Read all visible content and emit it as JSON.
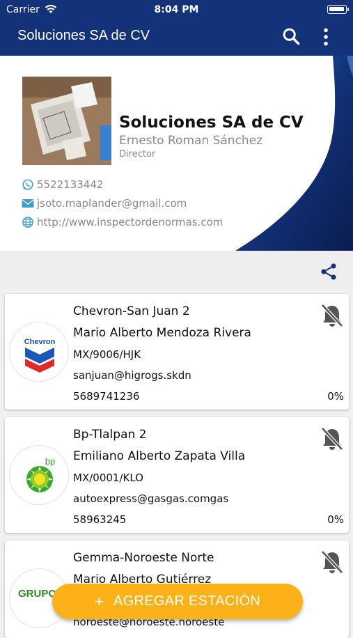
{
  "status_bar": {
    "carrier": "Carrier",
    "time": "8:04 PM"
  },
  "app_bar": {
    "title": "Soluciones SA de CV",
    "icons": [
      "search-icon",
      "more-vert-icon"
    ]
  },
  "profile": {
    "company": "Soluciones SA de CV",
    "person": "Ernesto Roman Sánchez",
    "role": "Director",
    "phone": "5522133442",
    "email": "jsoto.maplander@gmail.com",
    "website": "http://www.inspectordenormas.com"
  },
  "share_bar": {
    "icon": "share-icon"
  },
  "stations": [
    {
      "name": "Chevron-San Juan 2",
      "contact": "Mario Alberto Mendoza Rivera",
      "code": "MX/9006/HJK",
      "email": "sanjuan@higrogs.skdn",
      "phone": "5689741236",
      "progress": "0%",
      "brand": "Chevron",
      "notifications": "off"
    },
    {
      "name": "Bp-Tlalpan 2",
      "contact": "Emiliano Alberto  Zapata Villa",
      "code": "MX/0001/KLO",
      "email": "autoexpress@gasgas.comgas",
      "phone": "58963245",
      "progress": "0%",
      "brand": "bp",
      "notifications": "off"
    },
    {
      "name": "Gemma-Noroeste Norte",
      "contact": "Mario Alberto Gutiérrez",
      "code": "",
      "email": "noroeste@noroeste.noroeste",
      "phone": "",
      "progress": "",
      "brand": "GRUPO GEMMA",
      "notifications": "off"
    }
  ],
  "fab": {
    "plus": "+",
    "label": "AGREGAR ESTACIÓN"
  },
  "colors": {
    "primary": "#13327a",
    "accent": "#fbb117",
    "muted": "#8a8a8a"
  }
}
